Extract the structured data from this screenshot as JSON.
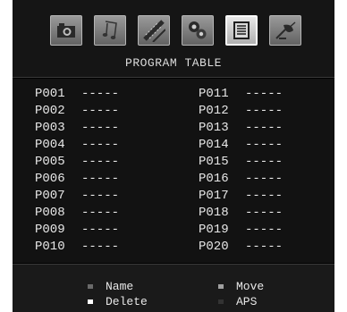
{
  "header": {
    "title": "PROGRAM TABLE",
    "tabs": [
      {
        "icon": "camera-icon",
        "active": false
      },
      {
        "icon": "music-note-icon",
        "active": false
      },
      {
        "icon": "film-strip-icon",
        "active": false
      },
      {
        "icon": "settings-gears-icon",
        "active": false
      },
      {
        "icon": "program-list-icon",
        "active": true
      },
      {
        "icon": "satellite-dish-icon",
        "active": false
      }
    ]
  },
  "programs": {
    "left": [
      {
        "num": "P001",
        "name": "-----"
      },
      {
        "num": "P002",
        "name": "-----"
      },
      {
        "num": "P003",
        "name": "-----"
      },
      {
        "num": "P004",
        "name": "-----"
      },
      {
        "num": "P005",
        "name": "-----"
      },
      {
        "num": "P006",
        "name": "-----"
      },
      {
        "num": "P007",
        "name": "-----"
      },
      {
        "num": "P008",
        "name": "-----"
      },
      {
        "num": "P009",
        "name": "-----"
      },
      {
        "num": "P010",
        "name": "-----"
      }
    ],
    "right": [
      {
        "num": "P011",
        "name": "-----"
      },
      {
        "num": "P012",
        "name": "-----"
      },
      {
        "num": "P013",
        "name": "-----"
      },
      {
        "num": "P014",
        "name": "-----"
      },
      {
        "num": "P015",
        "name": "-----"
      },
      {
        "num": "P016",
        "name": "-----"
      },
      {
        "num": "P017",
        "name": "-----"
      },
      {
        "num": "P018",
        "name": "-----"
      },
      {
        "num": "P019",
        "name": "-----"
      },
      {
        "num": "P020",
        "name": "-----"
      }
    ]
  },
  "legend": {
    "name": {
      "label": "Name",
      "color": "#6a6a6a"
    },
    "move": {
      "label": "Move",
      "color": "#a0a0a0"
    },
    "delete": {
      "label": "Delete",
      "color": "#ffffff"
    },
    "aps": {
      "label": "APS",
      "color": "#333333"
    }
  }
}
